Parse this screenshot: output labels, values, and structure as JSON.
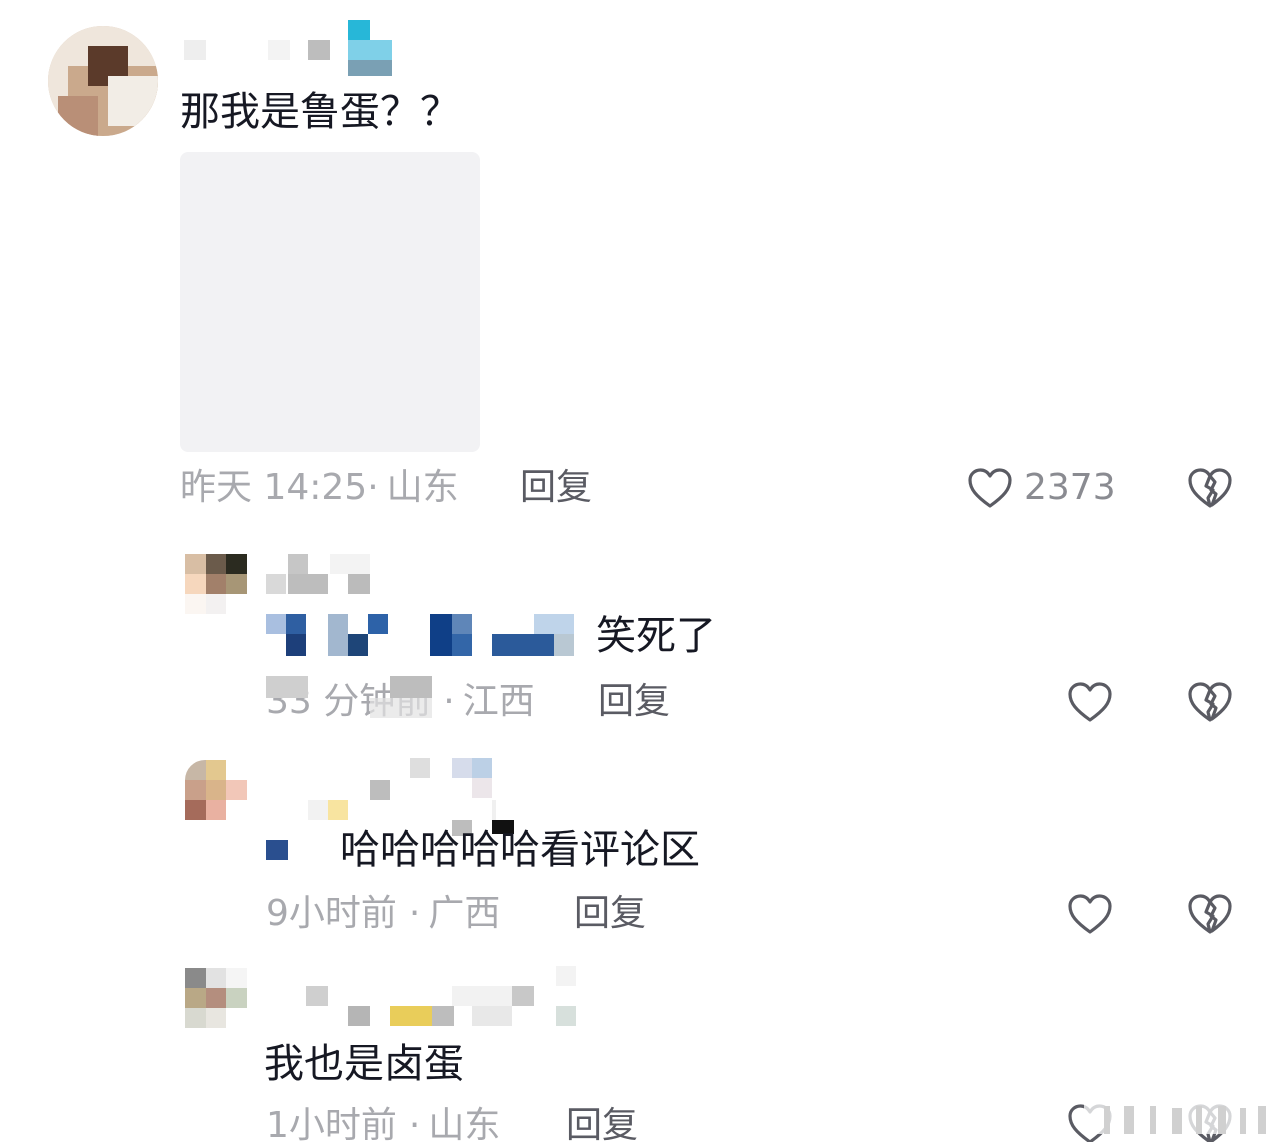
{
  "comments": [
    {
      "text": "那我是鲁蛋？？",
      "time": "昨天 14:25",
      "sep": "·",
      "location": "山东",
      "reply": "回复",
      "likes": "2373"
    },
    {
      "text": "笑死了",
      "time": "33 分钟前",
      "sep": "·",
      "location": "江西",
      "reply": "回复"
    },
    {
      "text": "哈哈哈哈哈看评论区",
      "time": "9小时前",
      "sep": "·",
      "location": "广西",
      "reply": "回复"
    },
    {
      "text": "我也是卤蛋",
      "time": "1小时前",
      "sep": "·",
      "location": "山东",
      "reply": "回复"
    }
  ],
  "icons": {
    "like": "heart-outline-icon",
    "dislike": "broken-heart-icon"
  },
  "colors": {
    "text": "#161823",
    "meta": "#a8a9ae",
    "reply": "#5a5b63",
    "icon": "#5a5b63"
  }
}
